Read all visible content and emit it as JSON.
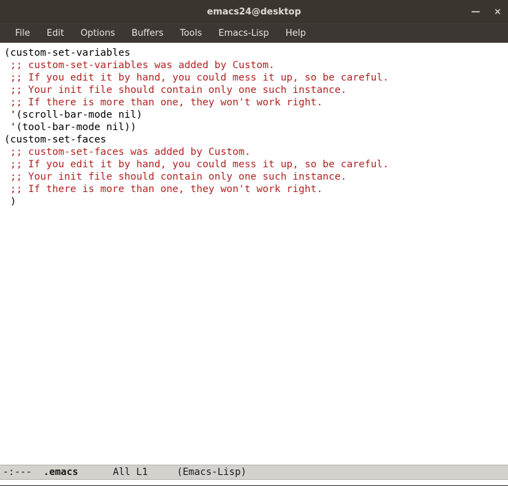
{
  "window": {
    "title": "emacs24@desktop",
    "minimize_glyph": "—",
    "close_glyph": "×"
  },
  "menu": {
    "items": [
      "File",
      "Edit",
      "Options",
      "Buffers",
      "Tools",
      "Emacs-Lisp",
      "Help"
    ]
  },
  "buffer": {
    "lines": [
      {
        "text": "(custom-set-variables",
        "cls": ""
      },
      {
        "text": " ;; custom-set-variables was added by Custom.",
        "cls": "comment"
      },
      {
        "text": " ;; If you edit it by hand, you could mess it up, so be careful.",
        "cls": "comment"
      },
      {
        "text": " ;; Your init file should contain only one such instance.",
        "cls": "comment"
      },
      {
        "text": " ;; If there is more than one, they won't work right.",
        "cls": "comment"
      },
      {
        "text": " '(scroll-bar-mode nil)",
        "cls": ""
      },
      {
        "text": " '(tool-bar-mode nil))",
        "cls": ""
      },
      {
        "text": "(custom-set-faces",
        "cls": ""
      },
      {
        "text": " ;; custom-set-faces was added by Custom.",
        "cls": "comment"
      },
      {
        "text": " ;; If you edit it by hand, you could mess it up, so be careful.",
        "cls": "comment"
      },
      {
        "text": " ;; Your init file should contain only one such instance.",
        "cls": "comment"
      },
      {
        "text": " ;; If there is more than one, they won't work right.",
        "cls": "comment"
      },
      {
        "text": " )",
        "cls": ""
      }
    ]
  },
  "modeline": {
    "status": "-:---",
    "buffer_name": ".emacs",
    "position": "All",
    "line": "L1",
    "mode": "(Emacs-Lisp)"
  }
}
